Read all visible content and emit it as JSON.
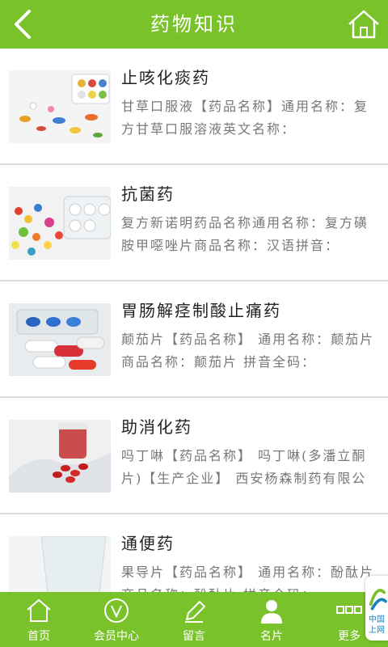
{
  "header": {
    "title": "药物知识",
    "back_icon": "chevron-left-icon",
    "home_icon": "home-icon"
  },
  "items": [
    {
      "name": "止咳化痰药",
      "desc": "甘草口服液【药品名称】通用名称：复方甘草口服溶液英文名称：",
      "image": "pills-tray-image"
    },
    {
      "name": "抗菌药",
      "desc": "复方新诺明药品名称通用名称：复方磺胺甲噁唑片商品名称：汉语拼音：",
      "image": "tablets-pile-image"
    },
    {
      "name": "胃肠解痉制酸止痛药",
      "desc": "颠茄片【药品名称】 通用名称：颠茄片 商品名称：颠茄片 拼音全码：",
      "image": "capsules-blister-image"
    },
    {
      "name": "助消化药",
      "desc": "吗丁啉【药品名称】 吗丁啉(多潘立酮片)【生产企业】 西安杨森制药有限公",
      "image": "gloved-hand-capsules-image"
    },
    {
      "name": "通便药",
      "desc": "果导片【药品名称】 通用名称：酚酞片 商品名称：酚酞片 拼音全码：",
      "image": "glass-pills-image"
    }
  ],
  "tabbar": [
    {
      "label": "首页",
      "icon": "home-icon"
    },
    {
      "label": "会员中心",
      "icon": "member-v-icon"
    },
    {
      "label": "留言",
      "icon": "pencil-icon"
    },
    {
      "label": "名片",
      "icon": "person-icon"
    },
    {
      "label": "更多",
      "icon": "more-grid-icon"
    }
  ],
  "overlay": {
    "text": "中国上网"
  },
  "colors": {
    "brand": "#7ac22a",
    "text": "#222222",
    "desc": "#777777"
  }
}
